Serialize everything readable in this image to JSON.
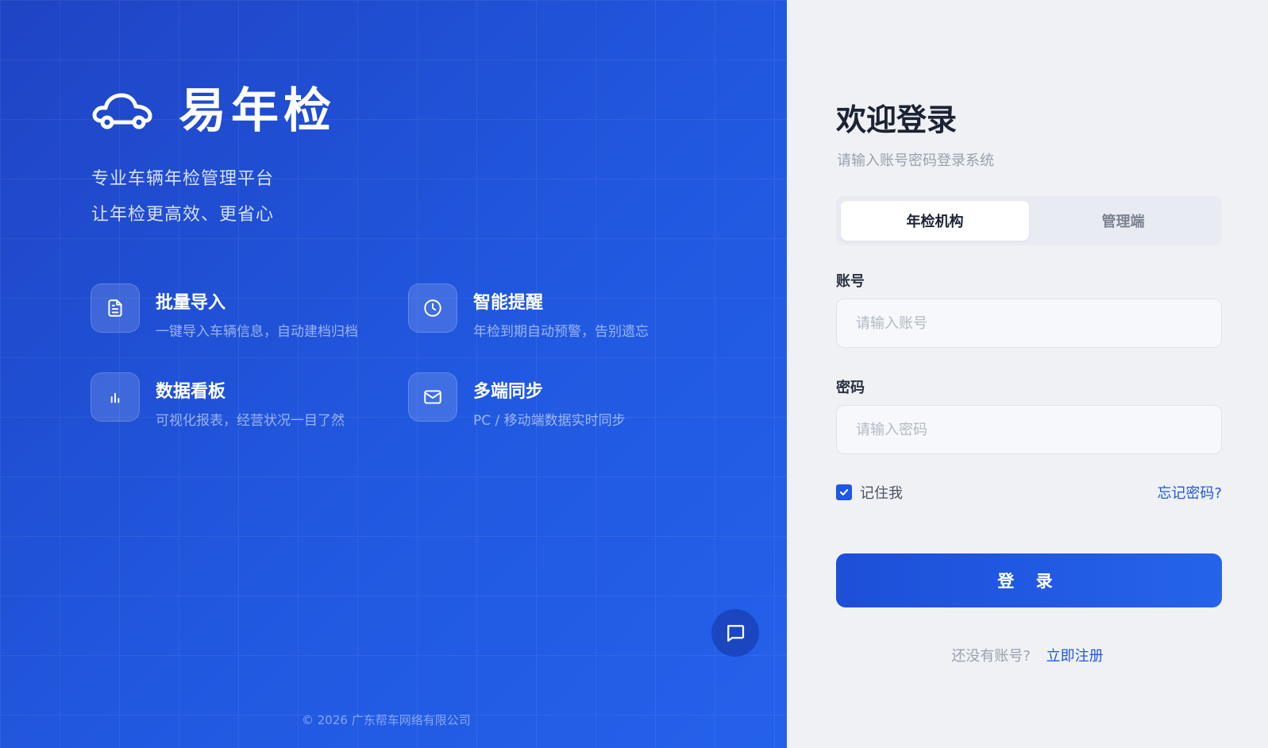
{
  "brand": {
    "title": "易年检",
    "tagline1": "专业车辆年检管理平台",
    "tagline2": "让年检更高效、更省心",
    "logo_icon": "car-cloud-icon"
  },
  "features": [
    {
      "icon": "document-icon",
      "title": "批量导入",
      "desc": "一键导入车辆信息，自动建档归档"
    },
    {
      "icon": "clock-icon",
      "title": "智能提醒",
      "desc": "年检到期自动预警，告别遗忘"
    },
    {
      "icon": "bar-chart-icon",
      "title": "数据看板",
      "desc": "可视化报表，经营状况一目了然"
    },
    {
      "icon": "mail-icon",
      "title": "多端同步",
      "desc": "PC / 移动端数据实时同步"
    }
  ],
  "copyright": "© 2026 广东帮车网络有限公司",
  "login": {
    "heading": "欢迎登录",
    "subtitle": "请输入账号密码登录系统",
    "tabs": [
      {
        "label": "年检机构",
        "active": true
      },
      {
        "label": "管理端",
        "active": false
      }
    ],
    "account_label": "账号",
    "account_placeholder": "请输入账号",
    "account_value": "",
    "password_label": "密码",
    "password_placeholder": "请输入密码",
    "password_value": "",
    "remember_label": "记住我",
    "remember_checked": true,
    "forgot_label": "忘记密码?",
    "submit_label": "登 录",
    "register_prompt": "还没有账号?",
    "register_link": "立即注册"
  },
  "colors": {
    "brand_blue": "#2158e0",
    "accent": "#1f57e6",
    "panel_bg": "#eff1f5"
  }
}
